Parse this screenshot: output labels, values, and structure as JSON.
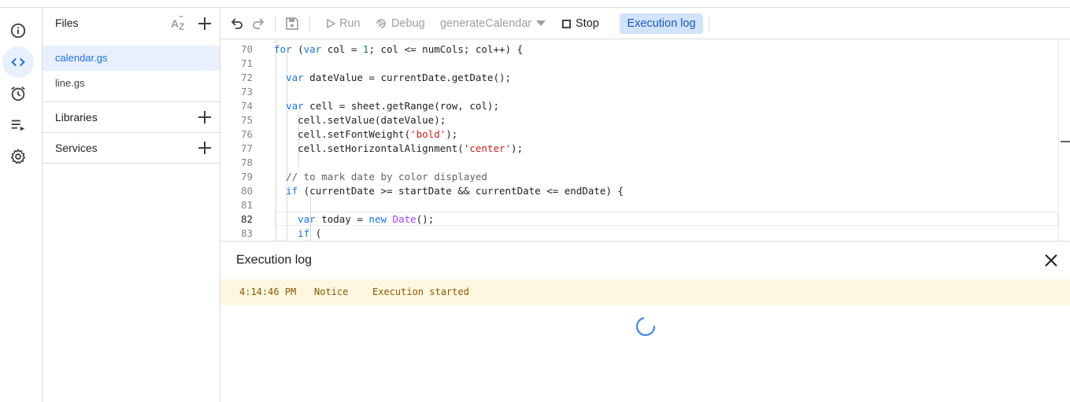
{
  "rail": {
    "items": [
      {
        "name": "info-icon"
      },
      {
        "name": "code-icon",
        "active": true
      },
      {
        "name": "alarm-icon"
      },
      {
        "name": "playlist-play-icon"
      },
      {
        "name": "gear-icon"
      }
    ]
  },
  "files": {
    "title": "Files",
    "sort_icon": "sort-az-icon",
    "items": [
      {
        "label": "calendar.gs",
        "selected": true
      },
      {
        "label": "line.gs",
        "selected": false
      }
    ],
    "libraries_label": "Libraries",
    "services_label": "Services"
  },
  "toolbar": {
    "run_label": "Run",
    "debug_label": "Debug",
    "function_name": "generateCalendar",
    "stop_label": "Stop",
    "execution_log_label": "Execution log"
  },
  "editor": {
    "current_line": "82",
    "lines": [
      {
        "n": "70",
        "code": "for (var col = 1; col <= numCols; col++) {"
      },
      {
        "n": "71",
        "code": ""
      },
      {
        "n": "72",
        "code": "  var dateValue = currentDate.getDate();"
      },
      {
        "n": "73",
        "code": ""
      },
      {
        "n": "74",
        "code": "  var cell = sheet.getRange(row, col);"
      },
      {
        "n": "75",
        "code": "    cell.setValue(dateValue);"
      },
      {
        "n": "76",
        "code": "    cell.setFontWeight('bold');"
      },
      {
        "n": "77",
        "code": "    cell.setHorizontalAlignment('center');"
      },
      {
        "n": "78",
        "code": ""
      },
      {
        "n": "79",
        "code": "  // to mark date by color displayed"
      },
      {
        "n": "80",
        "code": "  if (currentDate >= startDate && currentDate <= endDate) {"
      },
      {
        "n": "81",
        "code": ""
      },
      {
        "n": "82",
        "code": "    var today = new Date();"
      },
      {
        "n": "83",
        "code": "    if ("
      }
    ]
  },
  "log": {
    "title": "Execution log",
    "entries": [
      {
        "time": "4:14:46 PM",
        "level": "Notice",
        "message": "Execution started"
      }
    ]
  },
  "colors": {
    "accent": "#1a73e8",
    "selected_bg": "#e8f0fe",
    "log_notice_bg": "#fef7e0",
    "keyword": "#1a73e8",
    "string": "#c5221f"
  }
}
